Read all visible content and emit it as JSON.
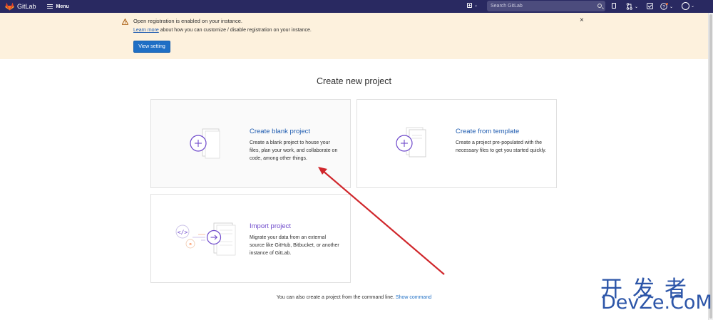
{
  "navbar": {
    "logo_text": "GitLab",
    "menu_label": "Menu",
    "search_placeholder": "Search GitLab",
    "icons": [
      "plus-square-icon",
      "search-icon",
      "issues-icon",
      "merge-request-icon",
      "todo-icon",
      "help-icon",
      "avatar-icon"
    ],
    "background": "#292961"
  },
  "alert": {
    "title": "Open registration is enabled on your instance.",
    "link_text": "Learn more",
    "message": " about how you can customize / disable registration on your instance.",
    "button_label": "View setting",
    "close_glyph": "×",
    "background": "#fdf1dd"
  },
  "page": {
    "title": "Create new project"
  },
  "cards": [
    {
      "title": "Create blank project",
      "description": "Create a blank project to house your files, plan your work, and collaborate on code, among other things."
    },
    {
      "title": "Create from template",
      "description": "Create a project pre-populated with the necessary files to get you started quickly."
    },
    {
      "title": "Import project",
      "description": "Migrate your data from an external source like GitHub, Bitbucket, or another instance of GitLab."
    }
  ],
  "footer": {
    "text": "You can also create a project from the command line.",
    "link": "Show command"
  },
  "watermark": {
    "chinese": "开发者",
    "latin": "DevZe.CoM"
  },
  "colors": {
    "accent": "#1f6fc5",
    "link": "#1f5cb0",
    "purple": "#6e49cb",
    "annotation_arrow": "#d0262b"
  }
}
